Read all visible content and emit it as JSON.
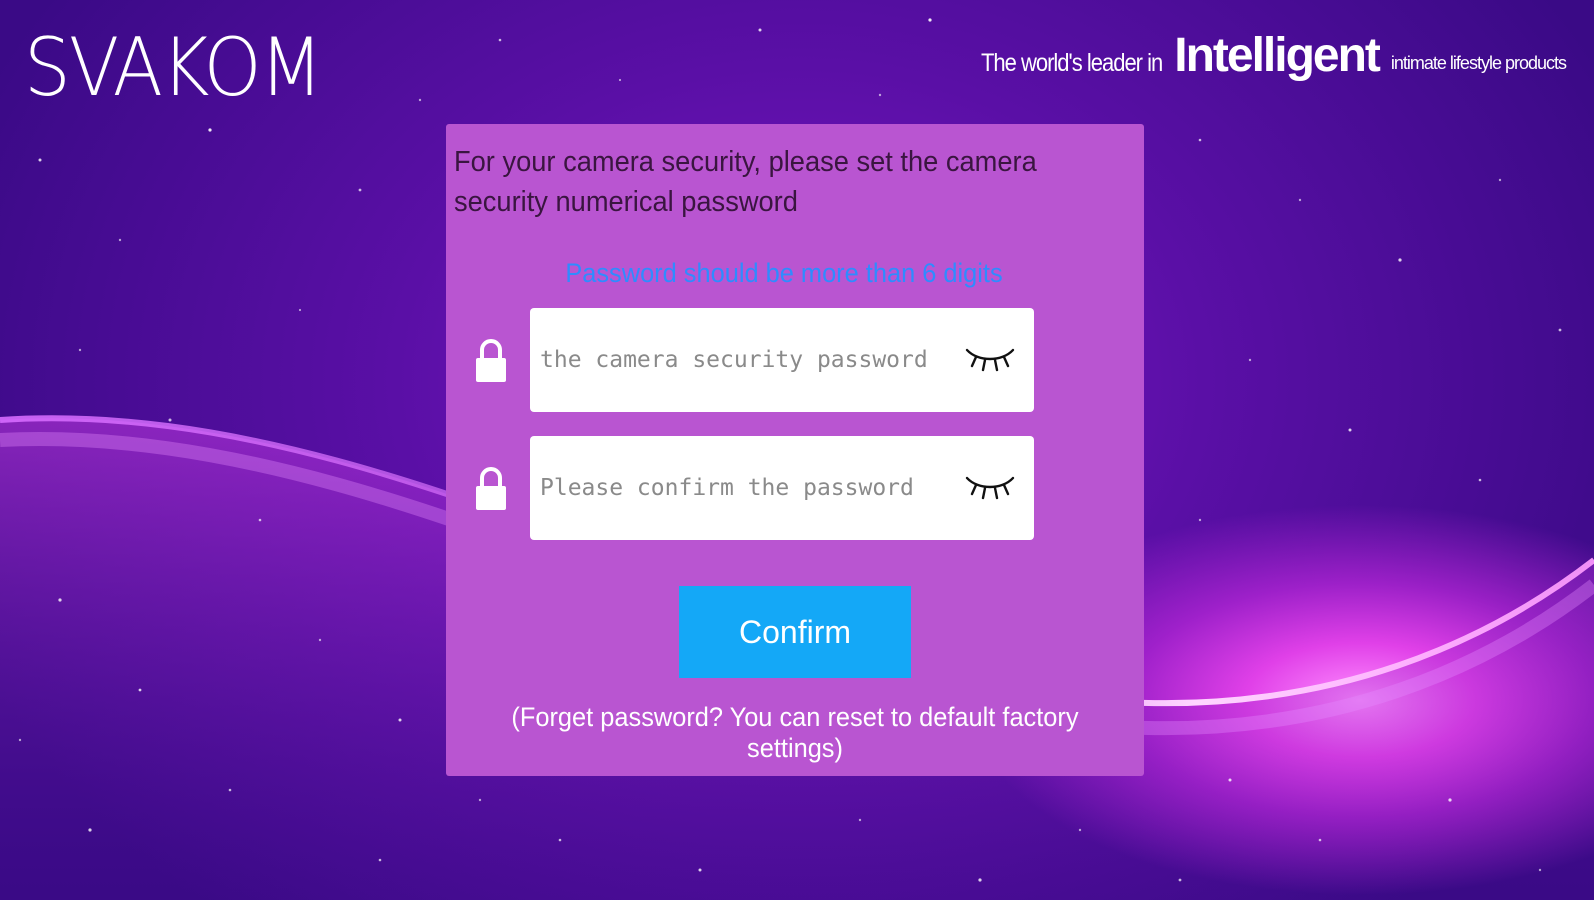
{
  "brand": {
    "logo": "SVAKOM",
    "tagline_prefix": "The world's leader in",
    "tagline_highlight": "Intelligent",
    "tagline_suffix": "intimate lifestyle products"
  },
  "dialog": {
    "title": "For your camera security, please set the camera security numerical password",
    "hint": "Password should be more than 6 digits",
    "password_field": {
      "placeholder": "the camera security password",
      "value": "",
      "icon": "lock-icon",
      "toggle_icon": "closed-eye-icon"
    },
    "confirm_field": {
      "placeholder": "Please confirm the password",
      "value": "",
      "icon": "lock-icon",
      "toggle_icon": "closed-eye-icon"
    },
    "confirm_label": "Confirm",
    "forget_text": "(Forget password? You can reset to default factory settings)"
  },
  "colors": {
    "card_background": "#b955d1",
    "hint": "#2e8cff",
    "confirm_button": "#14a8f7",
    "title_text": "#3a1540"
  }
}
